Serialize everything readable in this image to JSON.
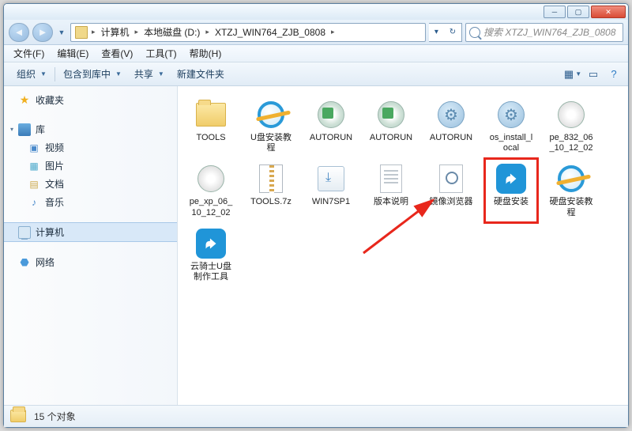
{
  "titlebar": {
    "min": "─",
    "max": "▢",
    "close": "✕"
  },
  "breadcrumb": {
    "segments": [
      "计算机",
      "本地磁盘 (D:)",
      "XTZJ_WIN764_ZJB_0808"
    ]
  },
  "search": {
    "placeholder": "搜索 XTZJ_WIN764_ZJB_0808"
  },
  "menu": {
    "file": "文件(F)",
    "edit": "编辑(E)",
    "view": "查看(V)",
    "tools": "工具(T)",
    "help": "帮助(H)"
  },
  "toolbar": {
    "organize": "组织",
    "include": "包含到库中",
    "share": "共享",
    "newfolder": "新建文件夹"
  },
  "sidebar": {
    "favorites": "收藏夹",
    "libraries": "库",
    "lib_items": [
      "视频",
      "图片",
      "文档",
      "音乐"
    ],
    "computer": "计算机",
    "network": "网络"
  },
  "files": [
    {
      "name": "TOOLS",
      "icon": "folder"
    },
    {
      "name": "U盘安装教程",
      "icon": "ie"
    },
    {
      "name": "AUTORUN",
      "icon": "discgreen"
    },
    {
      "name": "AUTORUN",
      "icon": "discgreen"
    },
    {
      "name": "AUTORUN",
      "icon": "gear"
    },
    {
      "name": "os_install_local",
      "icon": "gear"
    },
    {
      "name": "pe_832_06_10_12_02",
      "icon": "discplain"
    },
    {
      "name": "pe_xp_06_10_12_02",
      "icon": "discplain"
    },
    {
      "name": "TOOLS.7z",
      "icon": "zip"
    },
    {
      "name": "WIN7SP1",
      "icon": "box"
    },
    {
      "name": "版本说明",
      "icon": "txt"
    },
    {
      "name": "镜像浏览器",
      "icon": "search"
    },
    {
      "name": "硬盘安装",
      "icon": "blue",
      "highlight": true
    },
    {
      "name": "硬盘安装教程",
      "icon": "ie"
    },
    {
      "name": "云骑士U盘制作工具",
      "icon": "blue"
    }
  ],
  "status": {
    "count": "15 个对象"
  }
}
